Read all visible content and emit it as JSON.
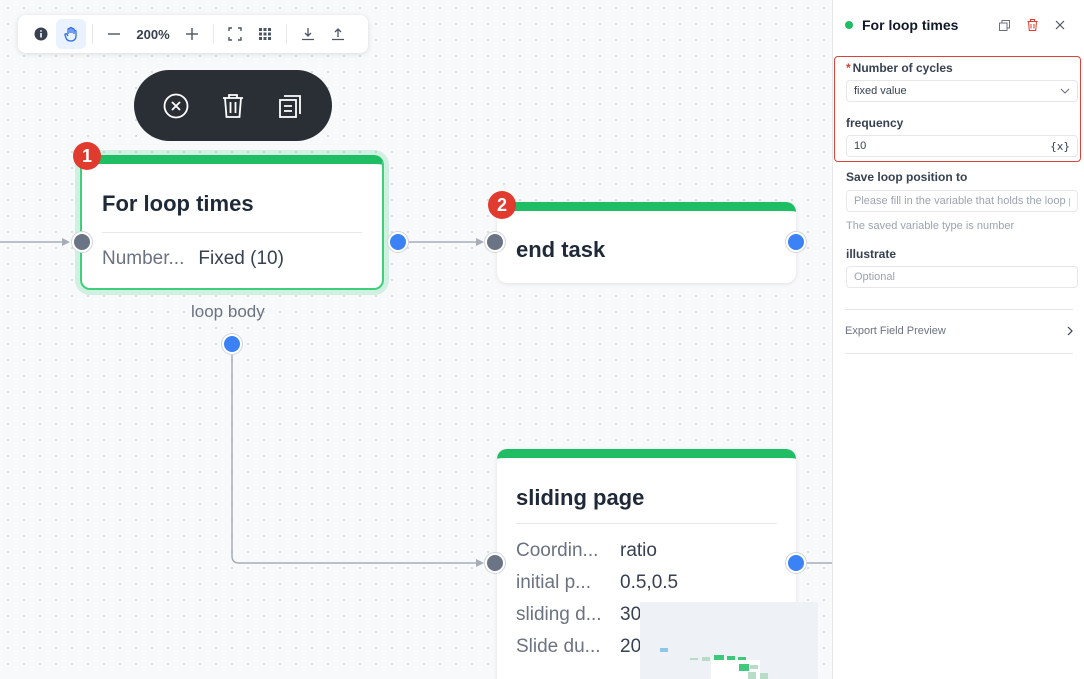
{
  "toolbar": {
    "zoom": "200%",
    "tools": [
      "info-icon",
      "hand-icon",
      "zoom-out-icon",
      "zoom-in-icon",
      "fit-view-icon",
      "grid-icon",
      "download-icon",
      "upload-icon"
    ]
  },
  "action_bar": {
    "icons": [
      "close-circle-icon",
      "trash-icon",
      "copy-icon"
    ]
  },
  "nodes": {
    "for_loop": {
      "badge": "1",
      "title": "For loop times",
      "row_key": "Number...",
      "row_value": "Fixed (10)",
      "loop_label": "loop body"
    },
    "end_task": {
      "badge": "2",
      "title": "end task"
    },
    "sliding_page": {
      "title": "sliding page",
      "rows": [
        {
          "key": "Coordin...",
          "value": "ratio"
        },
        {
          "key": "initial p...",
          "value": "0.5,0.5"
        },
        {
          "key": "sliding d...",
          "value": "30"
        },
        {
          "key": "Slide du...",
          "value": "20"
        }
      ]
    }
  },
  "panel": {
    "title": "For loop times",
    "status_color": "#1fbe65",
    "cycles_label": "Number of cycles",
    "cycles_required": "*",
    "cycles_value": "fixed value",
    "frequency_label": "frequency",
    "frequency_value": "10",
    "frequency_var_btn": "{x}",
    "save_label": "Save loop position to",
    "save_placeholder": "Please fill in the variable that holds the loop position",
    "save_hint": "The saved variable type is number",
    "illustrate_label": "illustrate",
    "illustrate_placeholder": "Optional",
    "export_label": "Export Field Preview"
  },
  "colors": {
    "accent_green": "#1fbe65",
    "port_blue": "#3b82f6",
    "badge_red": "#e03b2e"
  }
}
